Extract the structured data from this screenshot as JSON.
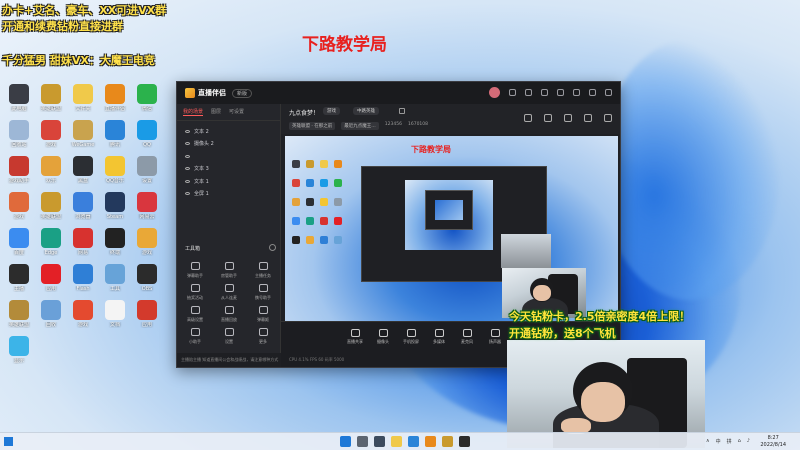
{
  "overlay": {
    "line1": "办卡+艾名、豪车、XX可进VX群",
    "line2": "开通和续费钻粉直接进群",
    "line3": "千分猛男 甜妹VX：大魔王电竞",
    "center_title": "下路教学局",
    "promo_line1": "今天钻粉卡，2.5倍亲密度4倍上限！",
    "promo_line2": "开通钻粉，送8个飞机"
  },
  "desktop_icons": [
    {
      "label": "此电脑",
      "color": "#3a3d45"
    },
    {
      "label": "英雄联盟",
      "color": "#c99a2e"
    },
    {
      "label": "文件夹",
      "color": "#f0c94a"
    },
    {
      "label": "直播伴侣",
      "color": "#e8891b"
    },
    {
      "label": "微信",
      "color": "#2bb24c"
    },
    {
      "label": "回收站",
      "color": "#9db7d6"
    },
    {
      "label": "游戏",
      "color": "#d9443a"
    },
    {
      "label": "WeGame",
      "color": "#c9a34e"
    },
    {
      "label": "腾讯",
      "color": "#2a84d8"
    },
    {
      "label": "QQ",
      "color": "#1a9be6"
    },
    {
      "label": "游戏助手",
      "color": "#c7392f"
    },
    {
      "label": "欢乐",
      "color": "#e4a23a"
    },
    {
      "label": "黑盒",
      "color": "#2b2e33"
    },
    {
      "label": "QQ音乐",
      "color": "#f3c531"
    },
    {
      "label": "设置",
      "color": "#8c9aa8"
    },
    {
      "label": "游戏",
      "color": "#e06a3b"
    },
    {
      "label": "英雄联盟",
      "color": "#c99a2e"
    },
    {
      "label": "浏览器",
      "color": "#3a7fdc"
    },
    {
      "label": "Steam",
      "color": "#23395d"
    },
    {
      "label": "网易云",
      "color": "#d9363e"
    },
    {
      "label": "百度",
      "color": "#3b8cf0"
    },
    {
      "label": "Edge",
      "color": "#1aa085"
    },
    {
      "label": "网易",
      "color": "#d7322f"
    },
    {
      "label": "终端",
      "color": "#222"
    },
    {
      "label": "游戏",
      "color": "#e9a837"
    },
    {
      "label": "主播",
      "color": "#2c2c2c"
    },
    {
      "label": "应用",
      "color": "#e32026"
    },
    {
      "label": "Flash",
      "color": "#2f7fd6"
    },
    {
      "label": "工具",
      "color": "#67a3d8"
    },
    {
      "label": "OBS",
      "color": "#2b2b2b"
    },
    {
      "label": "英雄联盟",
      "color": "#b38b3a"
    },
    {
      "label": "回收",
      "color": "#6aa0d8"
    },
    {
      "label": "游戏",
      "color": "#e44a2f"
    },
    {
      "label": "文档",
      "color": "#f4f4f4"
    },
    {
      "label": "应用",
      "color": "#d33a2c"
    },
    {
      "label": "显示",
      "color": "#3cb4e8"
    }
  ],
  "app": {
    "name": "直播伴侣",
    "version": "新版",
    "side_tabs": [
      "我的场景",
      "图层",
      "可设置"
    ],
    "scenes": [
      "文本 2",
      "摄像头 2",
      "",
      "文本 3",
      "文本 1",
      "全屏 1"
    ],
    "tools_title": "工具箱",
    "tools": [
      "弹幕助手",
      "房管助手",
      "主播任务",
      "抽奖活动",
      "从人连麦",
      "携号助手",
      "高级设置",
      "直播回放",
      "弹幕姬",
      "小助手",
      "设置",
      "更多"
    ],
    "sidebar_footer": "主播陪主播  知道直播间公会和战绩战，请注意哪种方式",
    "room_title": "九点食梦！",
    "room_chip1": "游戏",
    "room_chip2": "中路英雄",
    "meta_labels": [
      "英雄联盟 · 在那之前",
      "最近九点魔王…",
      "123456",
      "1670108"
    ],
    "bottom_tools": [
      "直播共享",
      "摄像头",
      "手机投屏",
      "多媒体",
      "麦克风",
      "扬声器"
    ],
    "bottom_stats": "CPU 4.1%  FPS 60  码率 5000"
  },
  "taskbar": {
    "time": "8:27",
    "date": "2022/8/14",
    "tray_items": [
      "∧",
      "中",
      "拼",
      "⌂",
      "♪"
    ]
  }
}
